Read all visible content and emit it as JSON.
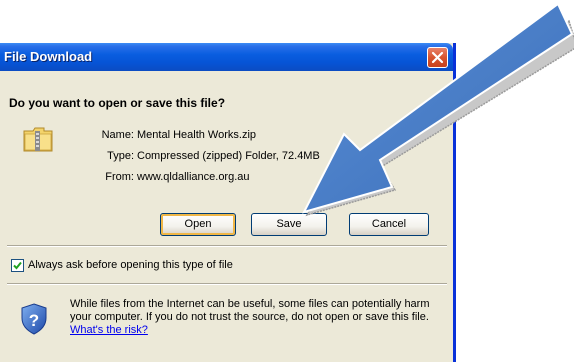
{
  "dialog": {
    "title": "File Download",
    "question": "Do you want to open or save this file?",
    "file_icon": "zip-folder-icon",
    "name_label": "Name:",
    "name_value": "Mental Health Works.zip",
    "type_label": "Type:",
    "type_value": "Compressed (zipped) Folder, 72.4MB",
    "from_label": "From:",
    "from_value": "www.qldalliance.org.au",
    "buttons": {
      "open": "Open",
      "save": "Save",
      "cancel": "Cancel"
    },
    "always_ask_label": "Always ask before opening this type of file",
    "always_ask_checked": true,
    "warning_text": "While files from the Internet can be useful, some files can potentially harm your computer. If you do not trust the source, do not open or save this file.",
    "risk_link": "What's the risk?"
  },
  "overlay": {
    "arrow_icon": "pointer-arrow-icon",
    "arrow_color": "#4a7fc8"
  },
  "colors": {
    "titlebar": "#0a5ee0",
    "window_bg": "#ece9d8",
    "close_button": "#d7542f",
    "default_button_glow": "#f0b747",
    "link": "#0000ee"
  }
}
